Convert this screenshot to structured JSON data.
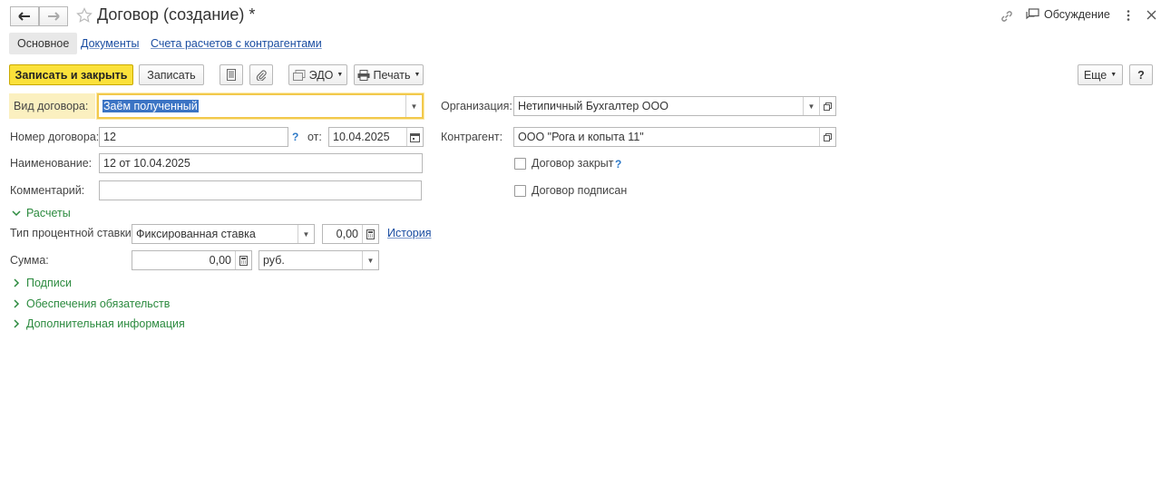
{
  "window": {
    "title": "Договор (создание) *",
    "discussion_label": "Обсуждение"
  },
  "tabs": [
    {
      "label": "Основное",
      "active": true
    },
    {
      "label": "Документы",
      "active": false
    },
    {
      "label": "Счета расчетов с контрагентами",
      "active": false
    }
  ],
  "toolbar": {
    "save_close_label": "Записать и закрыть",
    "save_label": "Записать",
    "edo_label": "ЭДО",
    "print_label": "Печать",
    "more_label": "Еще",
    "help_label": "?"
  },
  "form": {
    "contract_type": {
      "label": "Вид договора:",
      "value": "Заём полученный"
    },
    "organization": {
      "label": "Организация:",
      "value": "Нетипичный Бухгалтер ООО"
    },
    "contract_number": {
      "label": "Номер договора:",
      "value": "12"
    },
    "date": {
      "label": "от:",
      "value": "10.04.2025"
    },
    "counterparty": {
      "label": "Контрагент:",
      "value": "ООО \"Рога и копыта 11\""
    },
    "name": {
      "label": "Наименование:",
      "value": "12 от 10.04.2025"
    },
    "contract_closed": {
      "label": "Договор закрыт",
      "checked": false
    },
    "comment": {
      "label": "Комментарий:",
      "value": ""
    },
    "contract_signed": {
      "label": "Договор подписан",
      "checked": false
    }
  },
  "settlements": {
    "header": "Расчеты",
    "rate_type": {
      "label": "Тип процентной ставки:",
      "value": "Фиксированная ставка"
    },
    "rate_value": "0,00",
    "history_label": "История",
    "amount": {
      "label": "Сумма:",
      "value": "0,00"
    },
    "currency": "руб."
  },
  "groups": [
    {
      "label": "Подписи"
    },
    {
      "label": "Обеспечения обязательств"
    },
    {
      "label": "Дополнительная информация"
    }
  ],
  "colors": {
    "accent": "#fbe13a",
    "group_green": "#2b8a3e",
    "link_blue": "#1a4da1"
  }
}
